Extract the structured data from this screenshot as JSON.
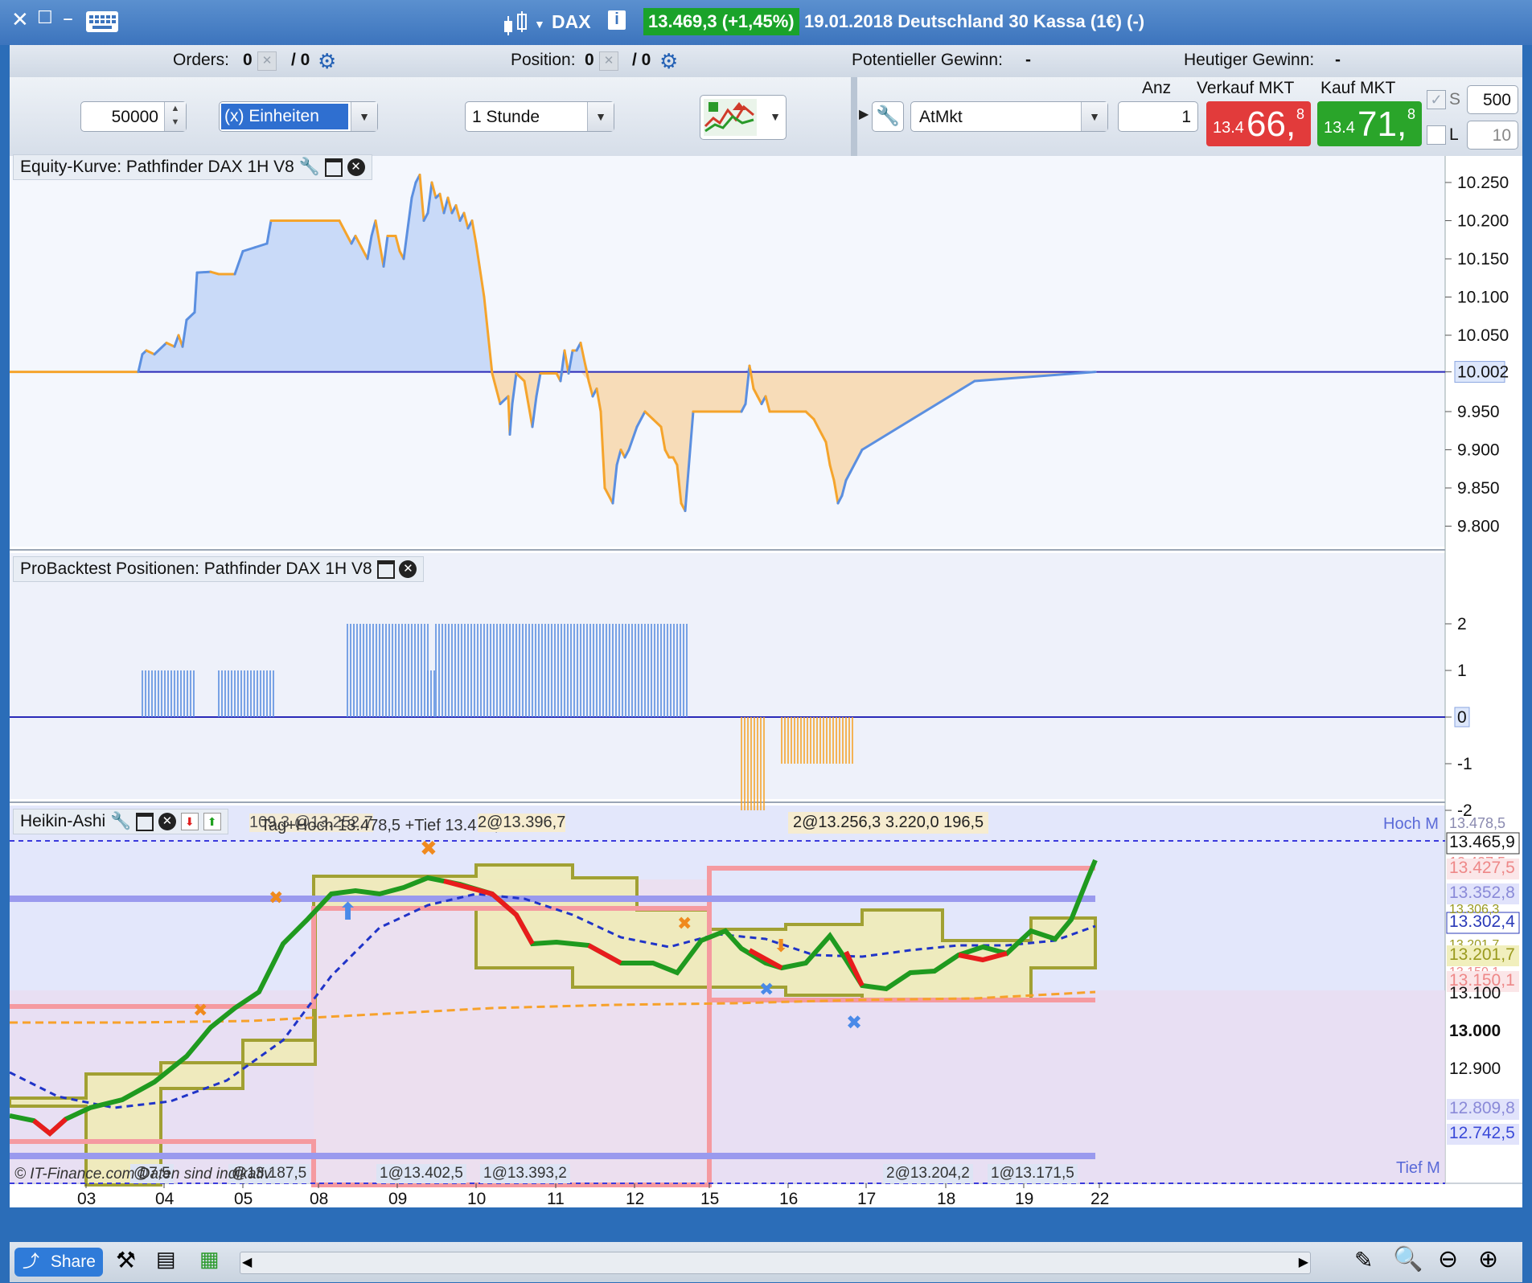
{
  "window": {
    "instrument": "DAX",
    "quote": "13.469,3 (+1,45%)",
    "quote_bg": "#1aa32a",
    "title": "19.01.2018 Deutschland 30 Kassa (1€) (-)"
  },
  "info": {
    "orders_label": "Orders:",
    "orders_a": "0",
    "orders_b": "/ 0",
    "position_label": "Position:",
    "position_a": "0",
    "position_b": "/ 0",
    "potential_label": "Potentieller Gewinn:",
    "potential_value": "-",
    "today_label": "Heutiger Gewinn:",
    "today_value": "-"
  },
  "toolbar": {
    "quantity": "50000",
    "unit": "(x) Einheiten",
    "timeframe": "1 Stunde",
    "order_type": "AtMkt",
    "anz_label": "Anz",
    "anz_value": "1",
    "sell_label": "Verkauf MKT",
    "buy_label": "Kauf MKT",
    "sell_small": "13.4",
    "sell_big": "66,",
    "sell_sup": "8",
    "buy_small": "13.4",
    "buy_big": "71,",
    "buy_sup": "8",
    "s_label": "S",
    "s_value": "500",
    "l_label": "L",
    "l_value": "10",
    "sell_color": "#e23b3b",
    "buy_color": "#2aa52a"
  },
  "panels": {
    "equity_title": "Equity-Kurve: Pathfinder DAX 1H V8",
    "positions_title": "ProBacktest Positionen: Pathfinder DAX 1H V8",
    "ha_title": "Heikin-Ashi",
    "ha_info_1": "109,3 @13.252,7",
    "ha_info_2": "Tag+Hoch 13.478,5 +Tief 13.412,5",
    "ha_info_3": "2@13.396,7",
    "ha_info_4": "2@13.256,3  3.220,0  196,5",
    "hoch_label": "Hoch M",
    "tief_label": "Tief M",
    "copyright": "© IT-Finance.com  Daten sind indikativ",
    "bottom_tags": [
      "@7,5",
      "@13.187,5",
      "1@13.402,5",
      "1@13.393,2",
      "2@13.204,2",
      "1@13.171,5"
    ]
  },
  "axes": {
    "equity_ticks": [
      "10.250",
      "10.200",
      "10.150",
      "10.100",
      "10.050",
      "10.002",
      "9.950",
      "9.900",
      "9.850",
      "9.800"
    ],
    "position_ticks": [
      "2",
      "1",
      "0",
      "-1",
      "-2"
    ],
    "price_ticks": [
      "13.478,5",
      "13.465,9",
      "13.427,5",
      "13.427,5",
      "13.352,8",
      "13.302,4",
      "13.306,3",
      "13.201,7",
      "13.201,7",
      "13.150,1",
      "13.150,1",
      "13.100",
      "13.000",
      "12.900",
      "12.809,8",
      "12.742,5"
    ],
    "dates": [
      "03",
      "04",
      "05",
      "08",
      "09",
      "10",
      "11",
      "12",
      "15",
      "16",
      "17",
      "18",
      "19",
      "22"
    ]
  },
  "chart_data": [
    {
      "type": "area",
      "title": "Equity-Kurve: Pathfinder DAX 1H V8",
      "baseline": 10002,
      "ylim": [
        9790,
        10270
      ],
      "x": [
        0,
        160,
        165,
        170,
        180,
        195,
        205,
        210,
        215,
        220,
        230,
        233,
        250,
        260,
        280,
        290,
        305,
        320,
        325,
        330,
        336,
        345,
        358,
        380,
        410,
        420,
        425,
        430,
        440,
        445,
        450,
        455,
        460,
        465,
        470,
        480,
        485,
        490,
        500,
        505,
        510,
        515,
        520,
        525,
        530,
        535,
        540,
        545,
        550,
        555,
        560,
        565,
        570,
        575,
        580,
        590,
        600,
        610,
        620,
        622,
        625,
        630,
        640,
        650,
        655,
        660,
        670,
        680,
        685,
        690,
        695,
        700,
        705,
        710,
        720,
        725,
        730,
        735,
        740,
        750,
        755,
        760,
        765,
        770,
        780,
        790,
        800,
        810,
        815,
        820,
        825,
        830,
        835,
        840,
        850,
        870,
        900,
        910,
        915,
        920,
        925,
        930,
        935,
        940,
        945,
        950,
        960,
        980,
        990,
        1000,
        1010,
        1015,
        1020,
        1025,
        1030,
        1035,
        1040,
        1045,
        1060,
        1200,
        1350
      ],
      "values": [
        10002,
        10002,
        10025,
        10030,
        10025,
        10040,
        10035,
        10050,
        10035,
        10070,
        10080,
        10132,
        10133,
        10130,
        10130,
        10160,
        10165,
        10170,
        10200,
        10200,
        10200,
        10200,
        10200,
        10200,
        10200,
        10180,
        10170,
        10180,
        10160,
        10150,
        10180,
        10200,
        10170,
        10140,
        10180,
        10180,
        10160,
        10150,
        10230,
        10250,
        10260,
        10200,
        10210,
        10250,
        10230,
        10235,
        10210,
        10230,
        10210,
        10220,
        10200,
        10210,
        10190,
        10200,
        10170,
        10100,
        10000,
        9960,
        9970,
        9920,
        9960,
        10000,
        9990,
        9930,
        9970,
        10000,
        10000,
        10000,
        9990,
        10030,
        10000,
        10030,
        10030,
        10040,
        9990,
        9970,
        9980,
        9950,
        9850,
        9830,
        9880,
        9900,
        9890,
        9900,
        9930,
        9950,
        9940,
        9930,
        9900,
        9890,
        9890,
        9880,
        9830,
        9820,
        9950,
        9950,
        9950,
        9950,
        9960,
        10010,
        9980,
        9970,
        9960,
        9970,
        9950,
        9950,
        9950,
        9950,
        9950,
        9940,
        9920,
        9910,
        9880,
        9860,
        9830,
        9840,
        9860,
        9870,
        9900,
        9990,
        10002,
        10002
      ]
    },
    {
      "type": "bar",
      "title": "ProBacktest Positionen: Pathfinder DAX 1H V8",
      "ylim": [
        -2,
        2
      ],
      "segments": [
        {
          "x_start": 165,
          "x_end": 232,
          "value": 1
        },
        {
          "x_start": 260,
          "x_end": 328,
          "value": 1
        },
        {
          "x_start": 420,
          "x_end": 520,
          "value": 2
        },
        {
          "x_start": 520,
          "x_end": 530,
          "value": 1
        },
        {
          "x_start": 530,
          "x_end": 845,
          "value": 2
        },
        {
          "x_start": 910,
          "x_end": 940,
          "value": -2
        },
        {
          "x_start": 960,
          "x_end": 1048,
          "value": -1
        }
      ]
    },
    {
      "type": "line",
      "title": "Heikin-Ashi",
      "ylim": [
        12720,
        13490
      ],
      "hoch": 13465.9,
      "tief": 12742.5,
      "resistance_upper": 13352.8,
      "support_lower": 12809.8,
      "last_price": 13465.9
    }
  ]
}
